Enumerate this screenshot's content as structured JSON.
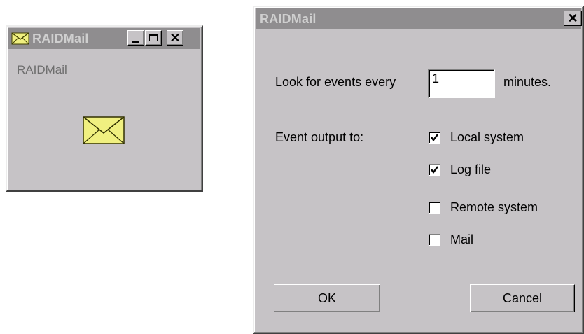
{
  "small_window": {
    "title": "RAIDMail",
    "body_label": "RAIDMail",
    "minimize_icon": "minimize-icon",
    "maximize_icon": "maximize-icon",
    "close_icon": "close-icon",
    "envelope_icon": "envelope-icon"
  },
  "dialog": {
    "title": "RAIDMail",
    "close_label": "X",
    "interval_label": "Look for events every",
    "interval_value": "1",
    "interval_unit": "minutes.",
    "output_label": "Event output to:",
    "outputs": [
      {
        "label": "Local system",
        "checked": true
      },
      {
        "label": "Log file",
        "checked": true
      },
      {
        "label": "Remote system",
        "checked": false
      },
      {
        "label": "Mail",
        "checked": false
      }
    ],
    "ok_label": "OK",
    "cancel_label": "Cancel"
  },
  "colors": {
    "face": "#c6c3c6",
    "title_inactive": "#8f8d8f",
    "envelope": "#f0f080"
  }
}
